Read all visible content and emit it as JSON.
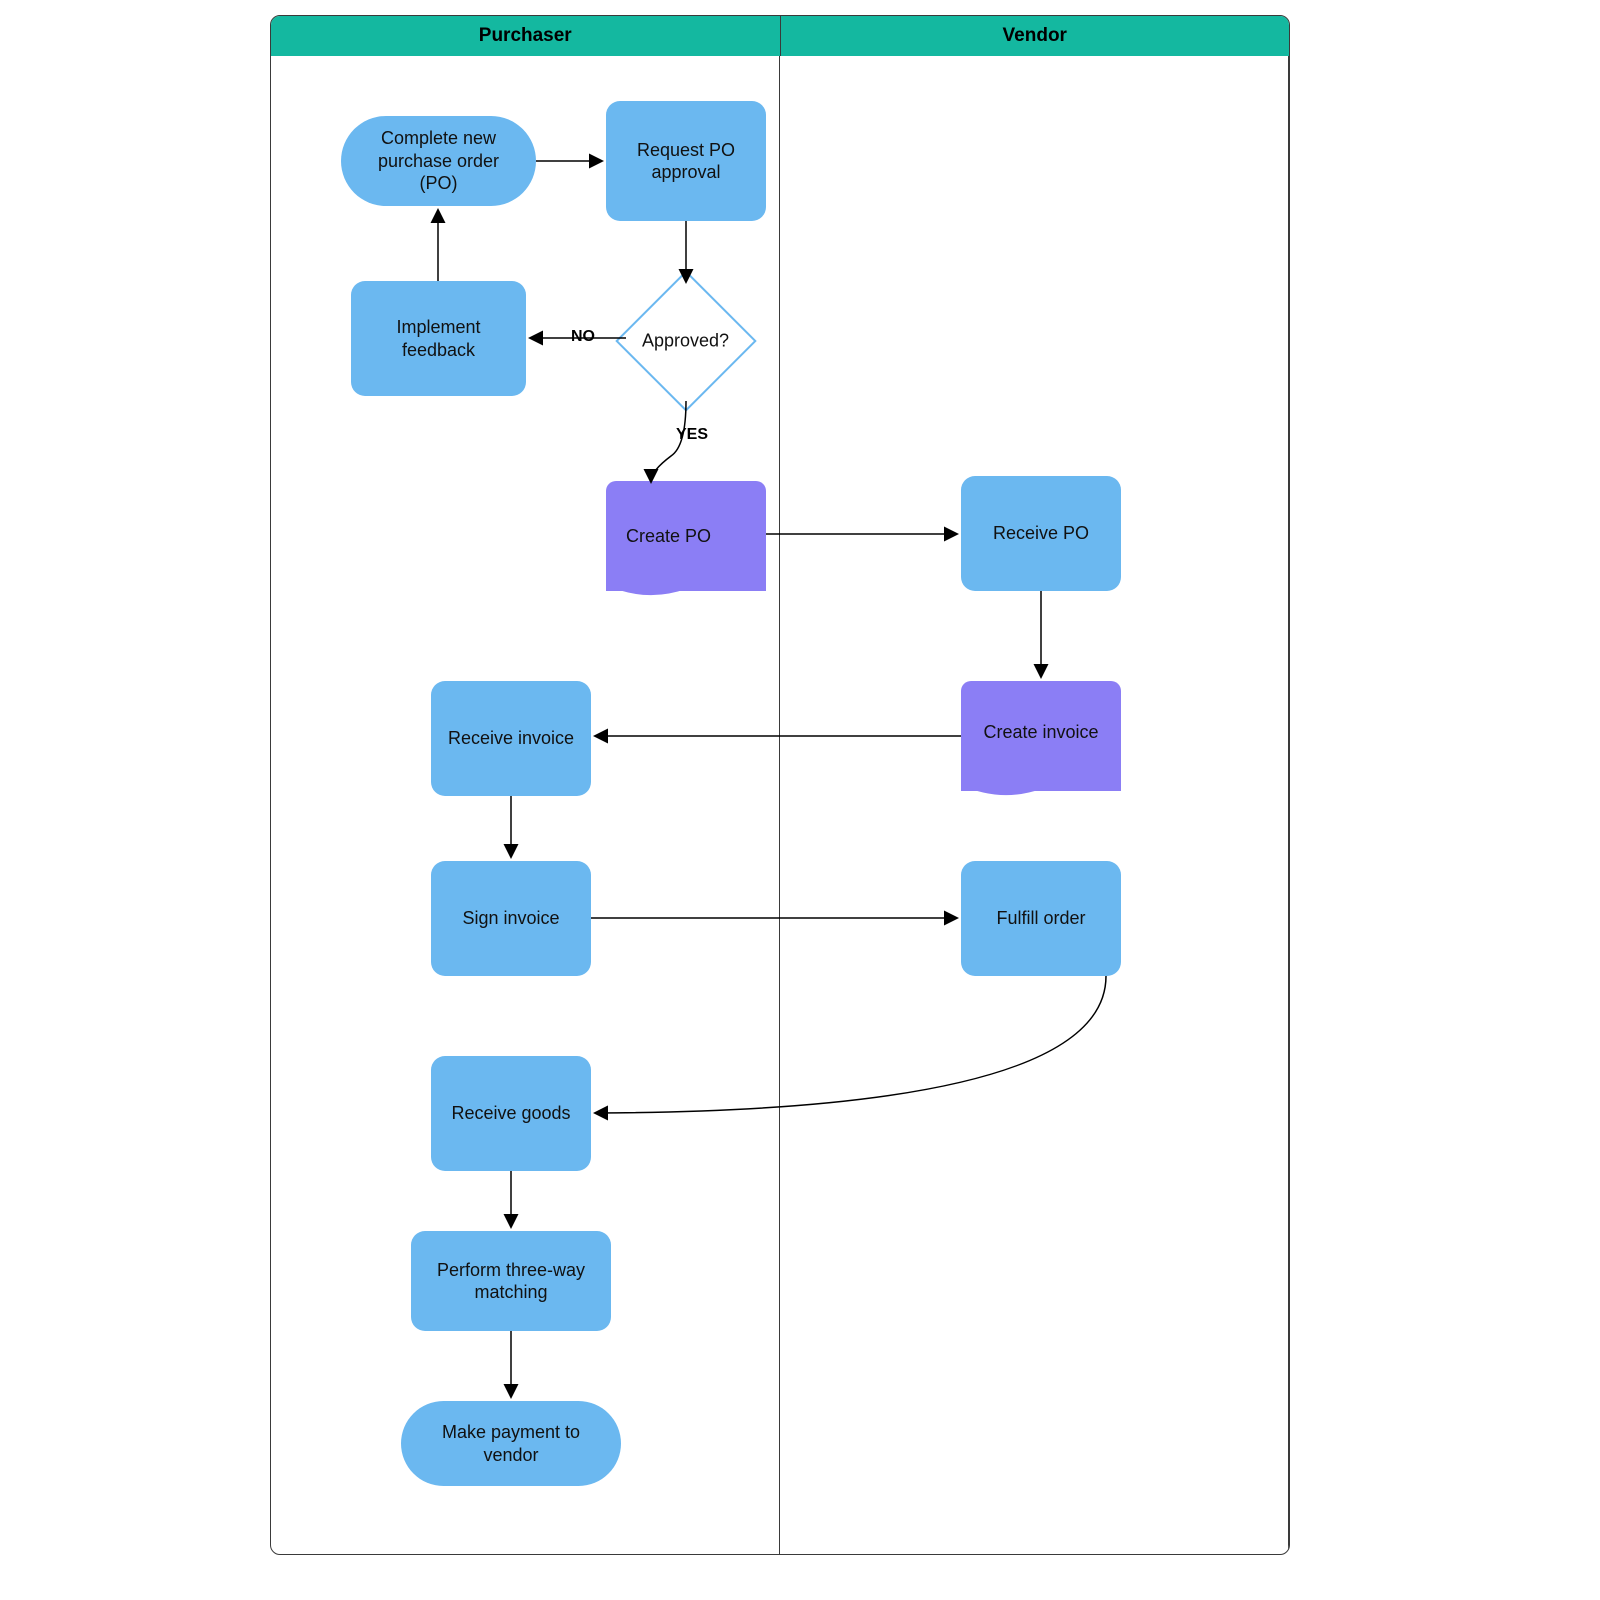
{
  "swimlanes": {
    "purchaser": "Purchaser",
    "vendor": "Vendor"
  },
  "nodes": {
    "complete_po": "Complete new\npurchase order\n(PO)",
    "request_approval": "Request PO\napproval",
    "implement_feedback": "Implement\nfeedback",
    "approved": "Approved?",
    "create_po": "Create PO",
    "receive_po": "Receive PO",
    "create_invoice": "Create invoice",
    "receive_invoice": "Receive invoice",
    "sign_invoice": "Sign invoice",
    "fulfill_order": "Fulfill order",
    "receive_goods": "Receive goods",
    "three_way": "Perform three-way\nmatching",
    "make_payment": "Make payment to\nvendor"
  },
  "edge_labels": {
    "no": "NO",
    "yes": "YES"
  },
  "colors": {
    "header": "#14b8a0",
    "process": "#6bb8f0",
    "document": "#8b7ef5",
    "border": "#3a3a3a"
  }
}
